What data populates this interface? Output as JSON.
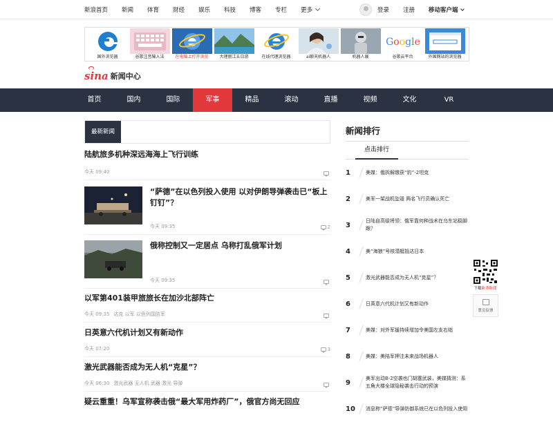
{
  "topnav": {
    "links": [
      "新浪首页",
      "新闻",
      "体育",
      "财经",
      "娱乐",
      "科技",
      "博客",
      "专栏"
    ],
    "more": "更多",
    "login": "登录",
    "register": "注册",
    "mobile": "移动客户端"
  },
  "ads": [
    {
      "caption": "国外浏览器",
      "red": false
    },
    {
      "caption": "谷歌注音输入法",
      "red": false
    },
    {
      "caption": "在电脑上打开浏览",
      "red": true
    },
    {
      "caption": "大理丽江五日游",
      "red": false
    },
    {
      "caption": "在线代理浏览器",
      "red": false
    },
    {
      "caption": "ai聊天机器人",
      "red": false
    },
    {
      "caption": "机器人展",
      "red": false
    },
    {
      "caption": "谷歌云平台",
      "red": false
    },
    {
      "caption": "外国网站的浏览器",
      "red": false
    }
  ],
  "logo": {
    "brand": "sina",
    "sub": "新闻中心"
  },
  "mainnav": [
    "首页",
    "国内",
    "国际",
    "军事",
    "精品",
    "滚动",
    "直播",
    "视频",
    "文化",
    "VR"
  ],
  "mainnav_active": "军事",
  "feed": {
    "tab": "最新新闻",
    "items": [
      {
        "title": "陆航旅多机种深远海海上飞行训练",
        "time": "今天 09:40",
        "tags": "",
        "comments": ""
      },
      {
        "title": "“萨德”在以色列投入使用 以对伊朗导弹袭击已“板上钉钉”？",
        "time": "今天 09:35",
        "tags": "",
        "comments": "2"
      },
      {
        "title": "俄称控制又一定居点 乌称打乱俄军计划",
        "time": "今天 09:35",
        "tags": "",
        "comments": ""
      },
      {
        "title": "以军第401装甲旅旅长在加沙北部阵亡",
        "time": "今天 09:35",
        "tags": "达克 以军 以色列国防军",
        "comments": ""
      },
      {
        "title": "日英意六代机计划又有新动作",
        "time": "今天 07:20",
        "tags": "",
        "comments": "3"
      },
      {
        "title": "激光武器能否成为无人机“克星”？",
        "time": "今天 06:30",
        "tags": "激光武器 无人机 武器 激光 导弹",
        "comments": ""
      },
      {
        "title": "疑云重重！乌军宣称袭击俄“最大军用炸药厂”，俄官方尚无回应",
        "time": "",
        "tags": "",
        "comments": ""
      }
    ]
  },
  "ranking": {
    "title": "新闻排行",
    "tab": "点击排行",
    "items": [
      {
        "num": "1",
        "text": "美媒：俄拆解缴获“豹”-2坦克"
      },
      {
        "num": "2",
        "text": "美军一架战机坠毁 两名飞行员确认死亡"
      },
      {
        "num": "3",
        "text": "日陆自高级将领：俄军靠何种战术在乌东站稳脚跟？"
      },
      {
        "num": "4",
        "text": "美“海狼”号核潜艇抵达日本"
      },
      {
        "num": "5",
        "text": "激光武器能否成为无人机“克星”？"
      },
      {
        "num": "6",
        "text": "日英意六代机计划又有新动作"
      },
      {
        "num": "7",
        "text": "美媒：对外军援持续增加令美国左支右绌"
      },
      {
        "num": "8",
        "text": "美媒：美陆军押注未来战场机器人"
      },
      {
        "num": "9",
        "text": "美军出动B-2空袭也门胡塞武装，美媒猜测：系五角大楼全球隐秘袭击行动的预演"
      },
      {
        "num": "10",
        "text": "消息称“萨德”导弹防御系统已在以色列投入使用"
      }
    ]
  },
  "sidebar": {
    "qr_label_pre": "下载",
    "qr_label_hl": "新浪新闻",
    "feedback": "意见反馈"
  }
}
